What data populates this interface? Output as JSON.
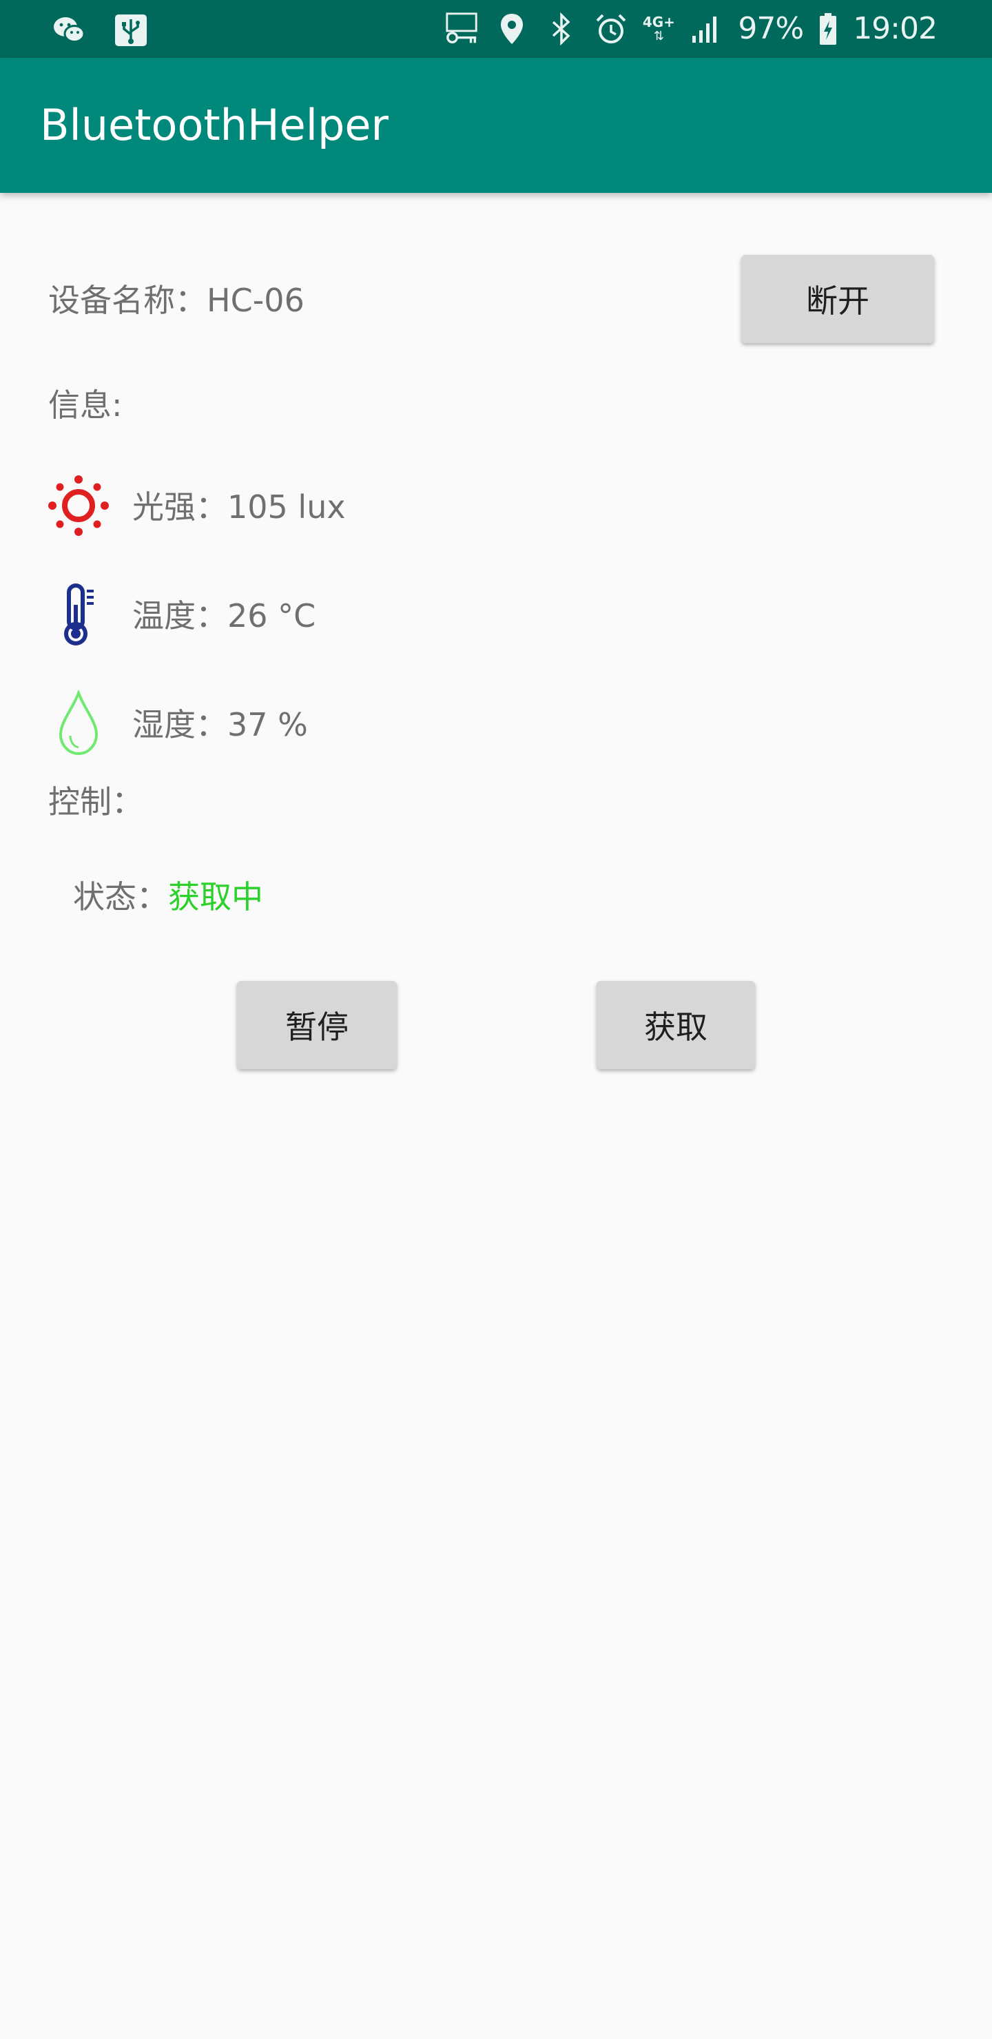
{
  "status_bar": {
    "battery_percent": "97%",
    "time": "19:02",
    "network": "4G+",
    "icons_left": [
      "wechat-icon",
      "usb-icon"
    ],
    "icons_right": [
      "vpn-key-icon",
      "location-icon",
      "bluetooth-icon",
      "alarm-icon",
      "network-4g-icon",
      "signal-icon",
      "battery-charging-icon"
    ]
  },
  "app_bar": {
    "title": "BluetoothHelper"
  },
  "device": {
    "name_label": "设备名称：HC-06",
    "disconnect_label": "断开"
  },
  "info": {
    "title": "信息:",
    "light": {
      "icon": "sun-icon",
      "text": "光强：105 lux"
    },
    "temperature": {
      "icon": "thermometer-icon",
      "text": "温度：26 °C"
    },
    "humidity": {
      "icon": "water-drop-icon",
      "text": "湿度：37 %"
    }
  },
  "control": {
    "title": "控制：",
    "status_prefix": "状态：",
    "status_value": "获取中",
    "pause_label": "暂停",
    "fetch_label": "获取"
  },
  "colors": {
    "status_bar": "#00695c",
    "app_bar": "#00897b",
    "background": "#fafafa",
    "button": "#d6d7d7",
    "status_value": "#2ad12a",
    "sun_icon": "#e02020",
    "thermometer_icon": "#1c2f8f",
    "drop_icon": "#6fea6f"
  }
}
